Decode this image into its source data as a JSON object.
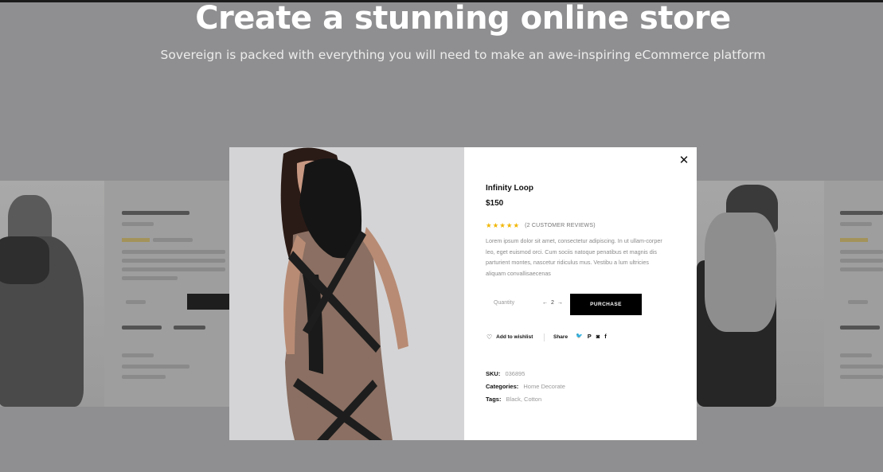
{
  "hero": {
    "title": "Create a stunning online store",
    "subtitle": "Sovereign is packed with everything you will need to make an awe-inspiring eCommerce platform"
  },
  "modal": {
    "close_symbol": "✕",
    "product_title": "Infinity Loop",
    "price": "$150",
    "rating_stars": "★★★★★",
    "rating_value": 5,
    "reviews": "(2 CUSTOMER REVIEWS)",
    "description": "Lorem ipsum dolor sit amet, consectetur adipiscing. In ut ullam-corper leo, eget euismod orci. Cum sociis natoque penatibus et magnis dis parturient montes, nascetur ridiculus mus. Vestibu a lum ultricies aliquam convallisaecenas",
    "quantity_label": "Quantity",
    "quantity_prev": "←",
    "quantity_value": "2",
    "quantity_next": "→",
    "purchase_label": "PURCHASE",
    "wishlist_icon": "♡",
    "wishlist_label": "Add to wishlist",
    "share_label": "Share",
    "social": {
      "twitter": "🐦",
      "pinterest": "P",
      "instagram": "◙",
      "facebook": "f"
    },
    "sku_label": "SKU:",
    "sku_value": "036895",
    "categories_label": "Categories:",
    "categories_value": "Home Decorate",
    "tags_label": "Tags:",
    "tags_value": "Black, Cotton"
  },
  "colors": {
    "overlay": "#8f8f91",
    "accent_star": "#f1b600",
    "button": "#000000"
  }
}
